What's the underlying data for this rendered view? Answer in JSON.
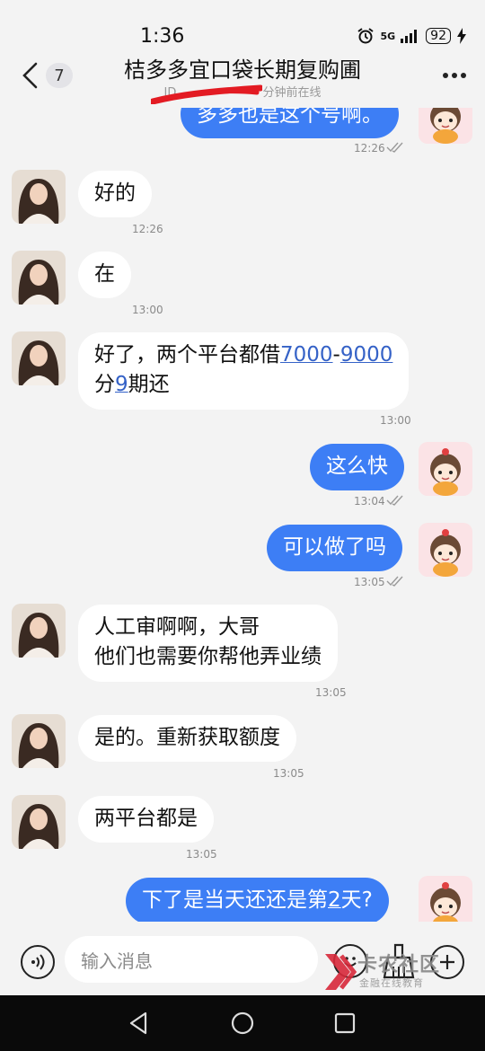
{
  "status": {
    "time": "1:36",
    "network": "5G",
    "battery": "92"
  },
  "header": {
    "back_count": "7",
    "title": "桔多多宜口袋长期复购圃",
    "subtitle_prefix": "ID.",
    "subtitle_suffix": "分钟前在线"
  },
  "messages": [
    {
      "side": "out",
      "text": "多多也是这个号啊。",
      "time": "12:26"
    },
    {
      "side": "in",
      "text": "好的",
      "time": "12:26"
    },
    {
      "side": "in",
      "text": "在",
      "time": "13:00"
    },
    {
      "side": "in",
      "line1_a": "好了，两个平台都借",
      "line1_link1": "7000",
      "line1_dash": "-",
      "line1_link2": "9000",
      "line2_a": "分",
      "line2_link": "9",
      "line2_b": "期还",
      "time": "13:00"
    },
    {
      "side": "out",
      "text": "这么快",
      "time": "13:04"
    },
    {
      "side": "out",
      "text": "可以做了吗",
      "time": "13:05"
    },
    {
      "side": "in",
      "line1": "人工审啊啊，大哥",
      "line2": "他们也需要你帮他弄业绩",
      "time": "13:05"
    },
    {
      "side": "in",
      "text": "是的。重新获取额度",
      "time": "13:05"
    },
    {
      "side": "in",
      "text": "两平台都是",
      "time": "13:05"
    },
    {
      "side": "out",
      "text_a": "下了是当天还还是第",
      "text_link": "2",
      "text_b": "天?",
      "time": ""
    }
  ],
  "input": {
    "placeholder": "输入消息"
  },
  "watermark": {
    "text": "卡农社区",
    "sub": "金融在线教育"
  },
  "colors": {
    "accent": "#3d7ef5",
    "background": "#f3f3f3",
    "link": "#3562c7"
  }
}
